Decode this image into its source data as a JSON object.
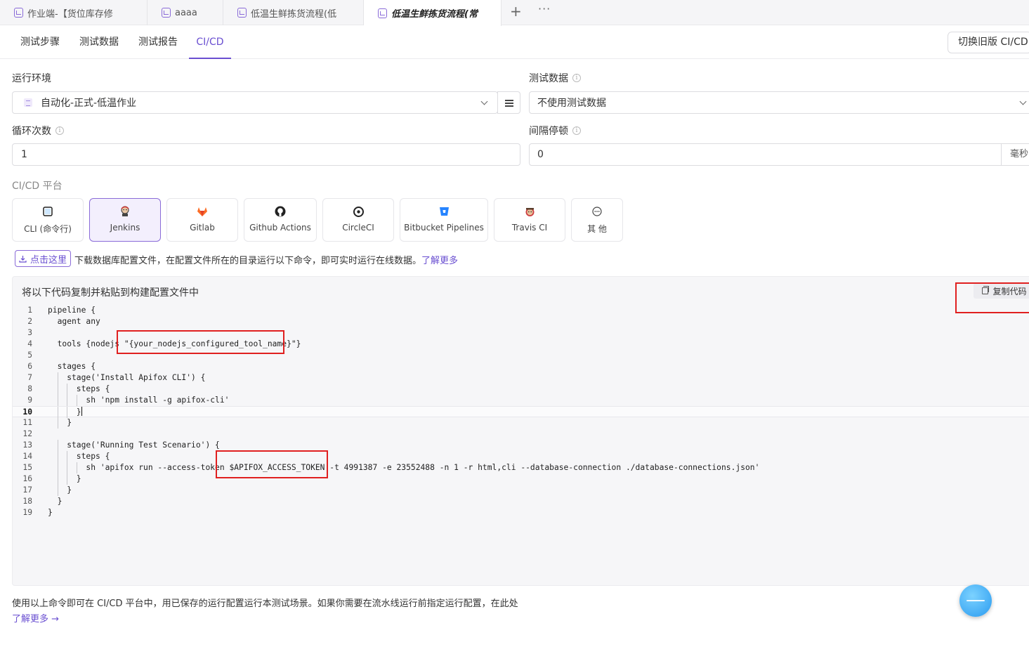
{
  "tabs": [
    {
      "label": "作业端-【货位库存修"
    },
    {
      "label": "aaaa"
    },
    {
      "label": "低温生鲜拣货流程(低"
    },
    {
      "label": "低温生鲜拣货流程(常"
    }
  ],
  "tab_actions": {
    "add": "+",
    "more": "···"
  },
  "subnav": {
    "items": [
      {
        "label": "测试步骤"
      },
      {
        "label": "测试数据"
      },
      {
        "label": "测试报告"
      },
      {
        "label": "CI/CD"
      }
    ],
    "active": "CI/CD",
    "switch_old_label": "切换旧版 CI/CD"
  },
  "form": {
    "env_label": "运行环境",
    "env_value": "自动化-正式-低温作业",
    "testdata_label": "测试数据",
    "testdata_value": "不使用测试数据",
    "loop_label": "循环次数",
    "loop_value": "1",
    "interval_label": "间隔停顿",
    "interval_value": "0",
    "interval_unit": "毫秒",
    "info_glyph": "i"
  },
  "platform": {
    "label": "CI/CD 平台",
    "active": "Jenkins",
    "cards": [
      {
        "label": "CLI (命令行)",
        "icon": "terminal-icon"
      },
      {
        "label": "Jenkins",
        "icon": "jenkins-icon"
      },
      {
        "label": "Gitlab",
        "icon": "gitlab-icon"
      },
      {
        "label": "Github Actions",
        "icon": "github-icon"
      },
      {
        "label": "CircleCI",
        "icon": "circleci-icon"
      },
      {
        "label": "Bitbucket Pipelines",
        "icon": "bitbucket-icon"
      },
      {
        "label": "Travis CI",
        "icon": "travis-icon"
      },
      {
        "label": "其 他",
        "icon": "more-circle-icon"
      }
    ]
  },
  "download": {
    "button_label": "点击这里",
    "hint_text": "下载数据库配置文件，在配置文件所在的目录运行以下命令，即可实时运行在线数据。",
    "learn_more": "了解更多"
  },
  "code_panel": {
    "title": "将以下代码复制并粘贴到构建配置文件中",
    "copy_label": "复制代码",
    "current_line": 10,
    "lines": [
      "pipeline {",
      "  agent any",
      "",
      "  tools {nodejs \"{your_nodejs_configured_tool_name}\"}",
      "",
      "  stages {",
      "    stage('Install Apifox CLI') {",
      "      steps {",
      "        sh 'npm install -g apifox-cli'",
      "      }",
      "    }",
      "",
      "    stage('Running Test Scenario') {",
      "      steps {",
      "        sh 'apifox run --access-token $APIFOX_ACCESS_TOKEN -t 4991387 -e 23552488 -n 1 -r html,cli --database-connection ./database-connections.json'",
      "      }",
      "    }",
      "  }",
      "}"
    ]
  },
  "footer": {
    "text": "使用以上命令即可在 CI/CD 平台中，用已保存的运行配置运行本测试场景。如果你需要在流水线运行前指定运行配置，在此处",
    "learn_more": "了解更多 →"
  },
  "colors": {
    "accent": "#6a4fd1",
    "highlight_box": "#e02020",
    "code_bg": "#f6f6f8"
  }
}
